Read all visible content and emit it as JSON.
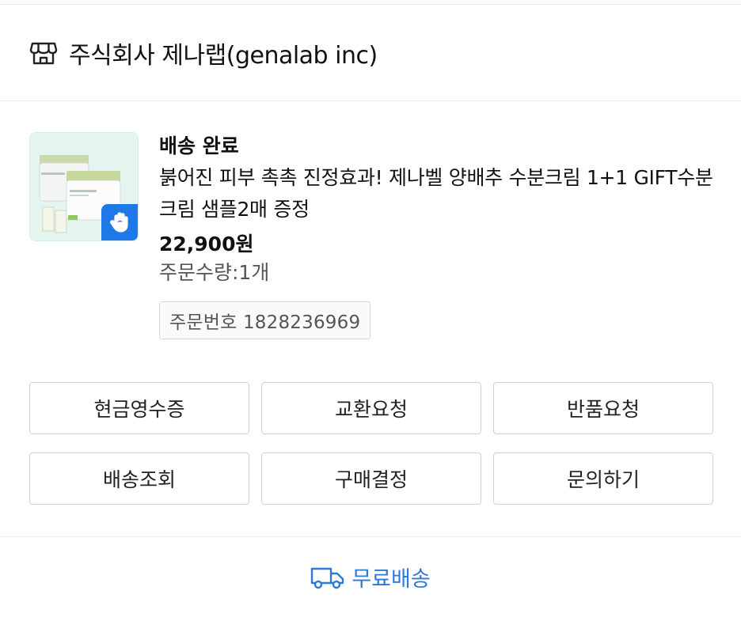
{
  "store": {
    "name": "주식회사 제나랩(genalab inc)",
    "icon": "store-icon"
  },
  "order": {
    "status": "배송 완료",
    "title": "붉어진 피부 촉촉 진정효과! 제나벨 양배추 수분크림 1+1 GIFT수분크림 샘플2매 증정",
    "price": "22,900원",
    "quantity": "주문수량:1개",
    "order_number": "주문번호 1828236969",
    "badge_icon": "hand-icon"
  },
  "actions": [
    {
      "label": "현금영수증"
    },
    {
      "label": "교환요청"
    },
    {
      "label": "반품요청"
    },
    {
      "label": "배송조회"
    },
    {
      "label": "구매결정"
    },
    {
      "label": "문의하기"
    }
  ],
  "shipping": {
    "label": "무료배송",
    "icon": "truck-icon"
  },
  "colors": {
    "accent": "#2f79d6",
    "badge": "#1f78e8"
  }
}
